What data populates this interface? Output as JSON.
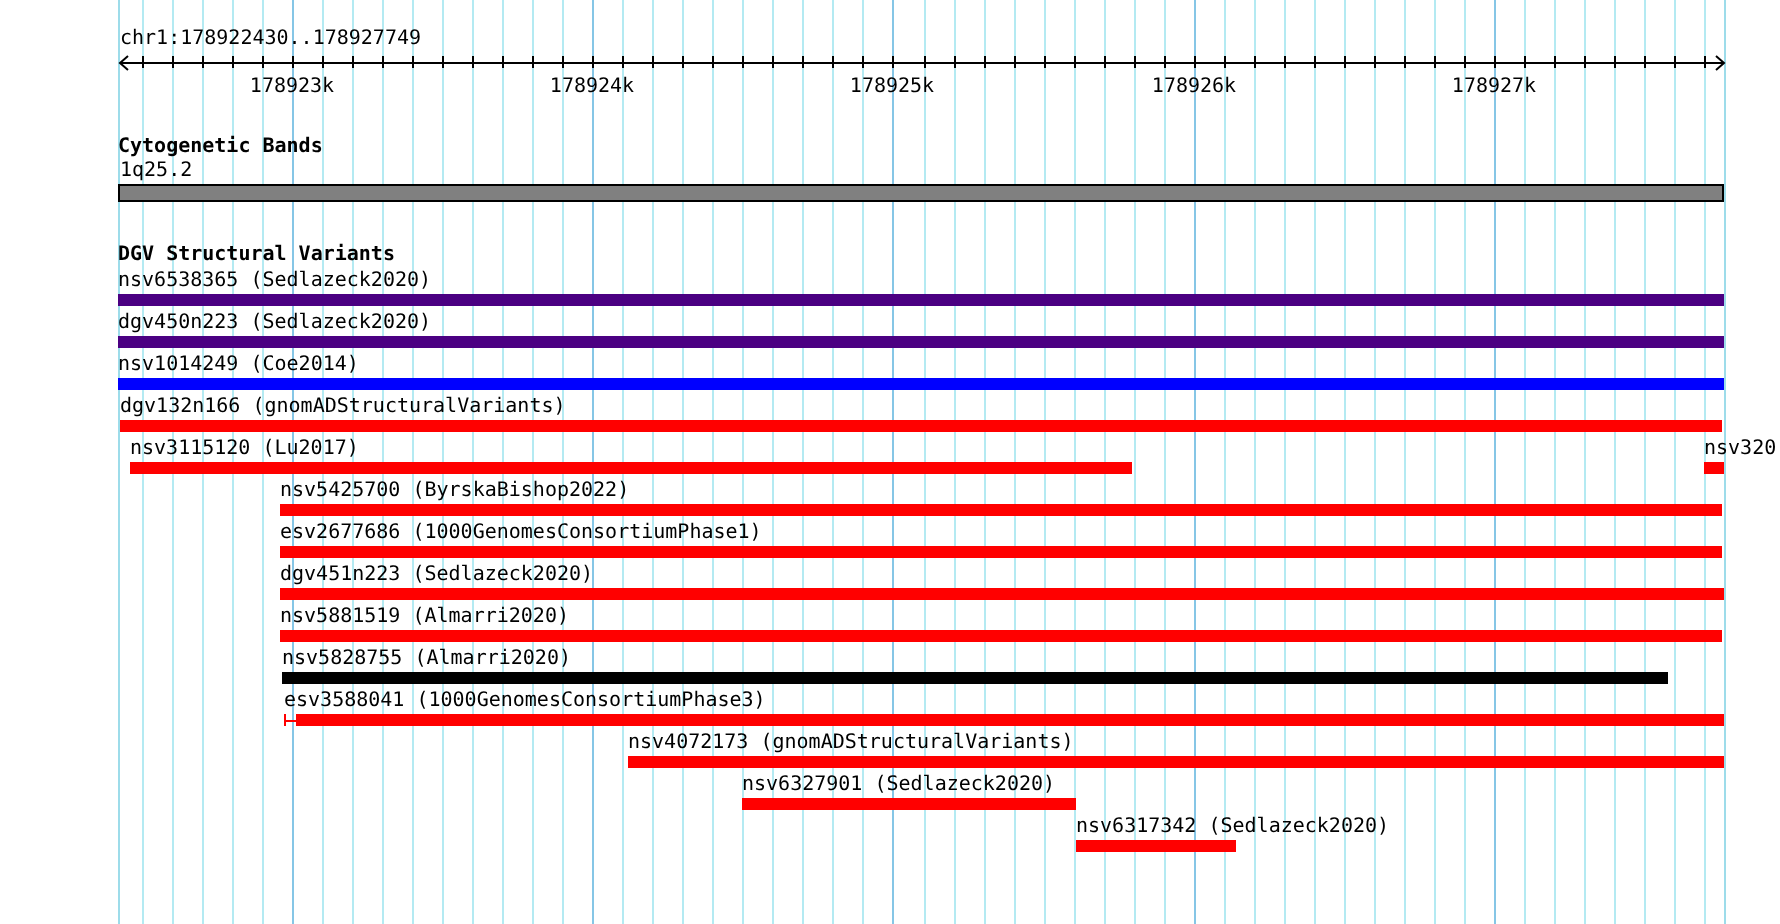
{
  "ruler": {
    "range_label": "chr1:178922430..178927749",
    "ticks": [
      "178923k",
      "178924k",
      "178925k",
      "178926k",
      "178927k"
    ]
  },
  "cytogenetic_bands": {
    "title": "Cytogenetic Bands",
    "band": {
      "label": "1q25.2"
    }
  },
  "structural_variants": {
    "title": "DGV Structural Variants",
    "rows": [
      [
        {
          "label": "nsv6538365 (Sedlazeck2020)",
          "color": "#4b0082",
          "kind": "bar"
        }
      ],
      [
        {
          "label": "dgv450n223 (Sedlazeck2020)",
          "color": "#4b0082",
          "kind": "bar"
        }
      ],
      [
        {
          "label": "nsv1014249 (Coe2014)",
          "color": "#0000ff",
          "kind": "bar"
        }
      ],
      [
        {
          "label": "dgv132n166 (gnomADStructuralVariants)",
          "color": "#ff0000",
          "kind": "bar"
        }
      ],
      [
        {
          "label": "nsv3115120 (Lu2017)",
          "color": "#ff0000",
          "kind": "bar"
        },
        {
          "label": "nsv320",
          "color": "#ff0000",
          "kind": "bar"
        }
      ],
      [
        {
          "label": "nsv5425700 (ByrskaBishop2022)",
          "color": "#ff0000",
          "kind": "bar"
        }
      ],
      [
        {
          "label": "esv2677686 (1000GenomesConsortiumPhase1)",
          "color": "#ff0000",
          "kind": "bar"
        }
      ],
      [
        {
          "label": "dgv451n223 (Sedlazeck2020)",
          "color": "#ff0000",
          "kind": "bar"
        }
      ],
      [
        {
          "label": "nsv5881519 (Almarri2020)",
          "color": "#ff0000",
          "kind": "bar"
        }
      ],
      [
        {
          "label": "nsv5828755 (Almarri2020)",
          "color": "#000000",
          "kind": "bar"
        }
      ],
      [
        {
          "label": "esv3588041 (1000GenomesConsortiumPhase3)",
          "color": "#ff0000",
          "kind": "whisker-bar"
        }
      ],
      [
        {
          "label": "nsv4072173 (gnomADStructuralVariants)",
          "color": "#ff0000",
          "kind": "bar"
        }
      ],
      [
        {
          "label": "nsv6327901 (Sedlazeck2020)",
          "color": "#ff0000",
          "kind": "bar"
        }
      ],
      [
        {
          "label": "nsv6317342 (Sedlazeck2020)",
          "color": "#ff0000",
          "kind": "bar"
        }
      ]
    ]
  }
}
